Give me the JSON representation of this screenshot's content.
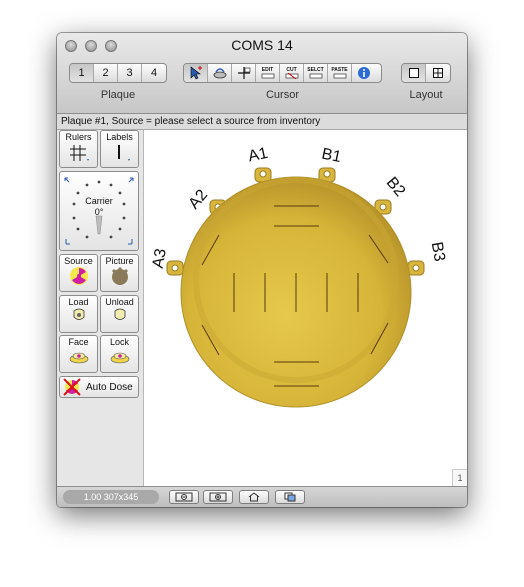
{
  "window": {
    "title": "COMS 14"
  },
  "toolbar": {
    "plaque_label": "Plaque",
    "plaque_buttons": [
      "1",
      "2",
      "3",
      "4"
    ],
    "plaque_selected": "1",
    "cursor_label": "Cursor",
    "cursor_buttons": [
      {
        "icon": "select-arrow-icon",
        "label": ""
      },
      {
        "icon": "pan-hand-icon",
        "label": ""
      },
      {
        "icon": "move-icon",
        "label": ""
      },
      {
        "icon": "edit-icon",
        "label": "EDIT"
      },
      {
        "icon": "cut-icon",
        "label": "CUT"
      },
      {
        "icon": "select-icon",
        "label": "SELCT"
      },
      {
        "icon": "paste-icon",
        "label": "PASTE"
      },
      {
        "icon": "info-icon",
        "label": ""
      }
    ],
    "layout_label": "Layout"
  },
  "status": {
    "text": "Plaque #1, Source = please select a source from inventory"
  },
  "sidebar": {
    "rulers": "Rulers",
    "labels": "Labels",
    "carrier": "Carrier",
    "carrier_angle": "0°",
    "source": "Source",
    "picture": "Picture",
    "load": "Load",
    "unload": "Unload",
    "face": "Face",
    "lock": "Lock",
    "auto_dose": "Auto Dose"
  },
  "plaque": {
    "lug_labels": [
      "A1",
      "B1",
      "A2",
      "B2",
      "A3",
      "B3"
    ],
    "color": "#d9b83c"
  },
  "canvas": {
    "page_indicator": "1"
  },
  "bottom": {
    "zoom_info": "1.00 307x345"
  }
}
